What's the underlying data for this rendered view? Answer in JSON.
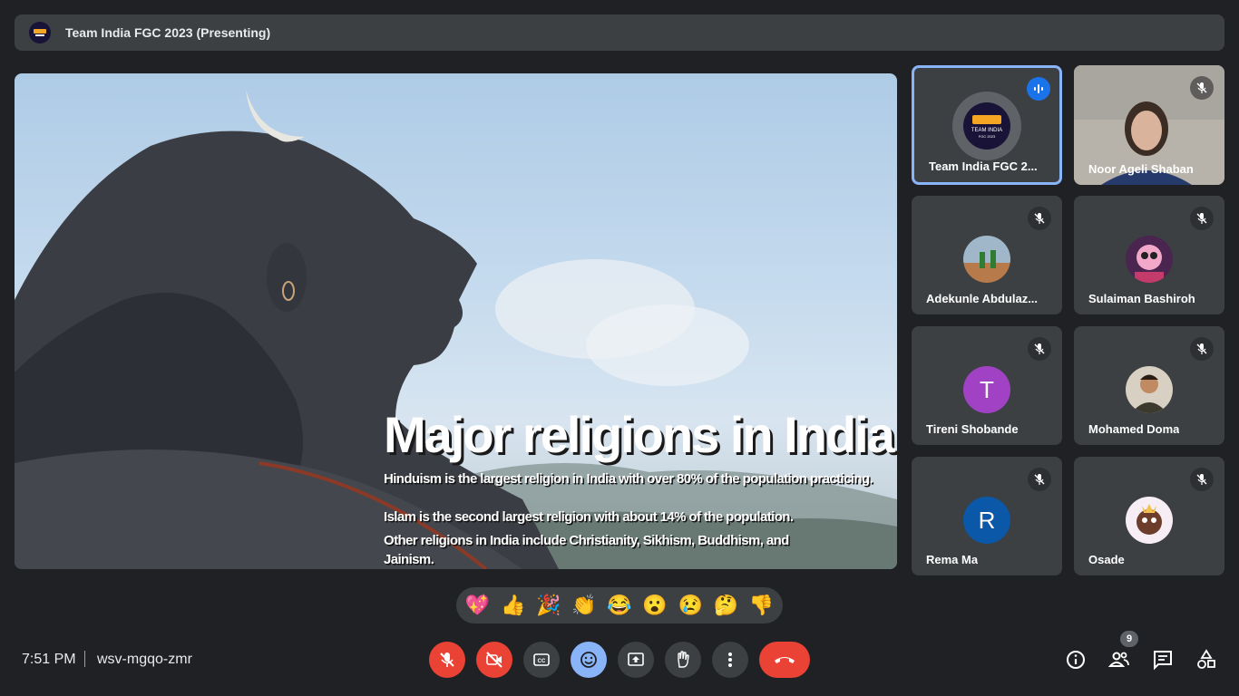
{
  "topbar": {
    "title": "Team India FGC 2023 (Presenting)",
    "logo_icon": "team-india-logo"
  },
  "slide": {
    "title": "Major religions in India",
    "lines": [
      "Hinduism is the largest religion in India with over 80% of the population practicing.",
      "Islam is the second largest religion with about 14% of the population.",
      "Other religions in India include Christianity, Sikhism, Buddhism, and",
      "Jainism."
    ]
  },
  "participants": [
    {
      "name": "Team India FGC 2...",
      "status": "speaking",
      "avatar": "team-india-logo"
    },
    {
      "name": "Noor Ageli Shaban",
      "status": "muted",
      "avatar": "video"
    },
    {
      "name": "Adekunle Abdulaz...",
      "status": "muted",
      "avatar": "photo"
    },
    {
      "name": "Sulaiman Bashiroh",
      "status": "muted",
      "avatar": "cartoon"
    },
    {
      "name": "Tireni Shobande",
      "status": "muted",
      "avatar_letter": "T",
      "avatar_color": "#a142c4"
    },
    {
      "name": "Mohamed Doma",
      "status": "muted",
      "avatar": "photo"
    },
    {
      "name": "Rema Ma",
      "status": "muted",
      "avatar_letter": "R",
      "avatar_color": "#0b57a8"
    },
    {
      "name": "Osade",
      "status": "muted",
      "avatar": "cartoon"
    }
  ],
  "reactions": [
    "💖",
    "👍",
    "🎉",
    "👏",
    "😂",
    "😮",
    "😢",
    "🤔",
    "👎"
  ],
  "meeting": {
    "time": "7:51 PM",
    "code": "wsv-mgqo-zmr"
  },
  "controls": [
    "mic-off",
    "camera-off",
    "captions",
    "emoji",
    "present",
    "raise-hand",
    "more-options",
    "end-call"
  ],
  "right_controls": {
    "participants_count": "9",
    "icons": [
      "info-icon",
      "people-icon",
      "chat-icon",
      "activities-icon"
    ]
  },
  "colors": {
    "background": "#202124",
    "surface": "#3c4043",
    "danger": "#ea4335",
    "accent": "#8ab4f8"
  }
}
